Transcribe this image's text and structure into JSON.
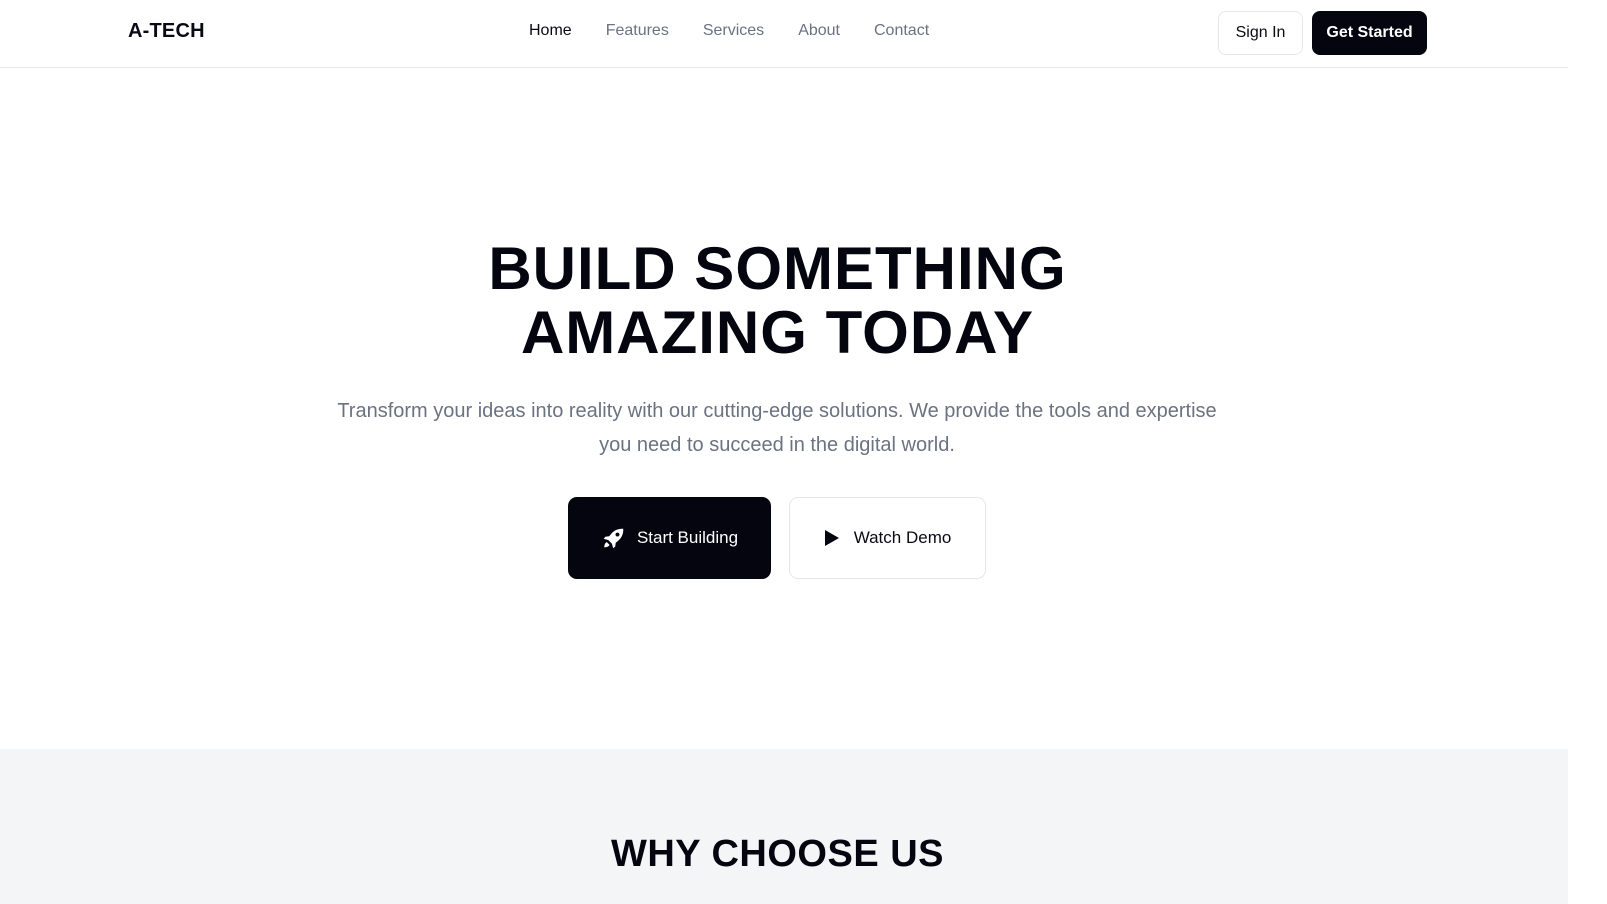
{
  "navbar": {
    "logo": "A-TECH",
    "links": [
      {
        "label": "Home",
        "active": true
      },
      {
        "label": "Features",
        "active": false
      },
      {
        "label": "Services",
        "active": false
      },
      {
        "label": "About",
        "active": false
      },
      {
        "label": "Contact",
        "active": false
      }
    ],
    "sign_in_label": "Sign In",
    "get_started_label": "Get Started"
  },
  "hero": {
    "title_line1": "BUILD SOMETHING",
    "title_line2": "AMAZING TODAY",
    "subtitle": "Transform your ideas into reality with our cutting-edge solutions. We provide the tools and expertise you need to succeed in the digital world.",
    "primary_button": {
      "label": "Start Building",
      "icon": "rocket-icon"
    },
    "secondary_button": {
      "label": "Watch Demo",
      "icon": "play-icon"
    }
  },
  "why": {
    "title": "WHY CHOOSE US"
  },
  "colors": {
    "primary": "#05050f",
    "muted_text": "#6b7280",
    "border": "#e5e7eb",
    "section_bg": "#f4f5f7"
  }
}
